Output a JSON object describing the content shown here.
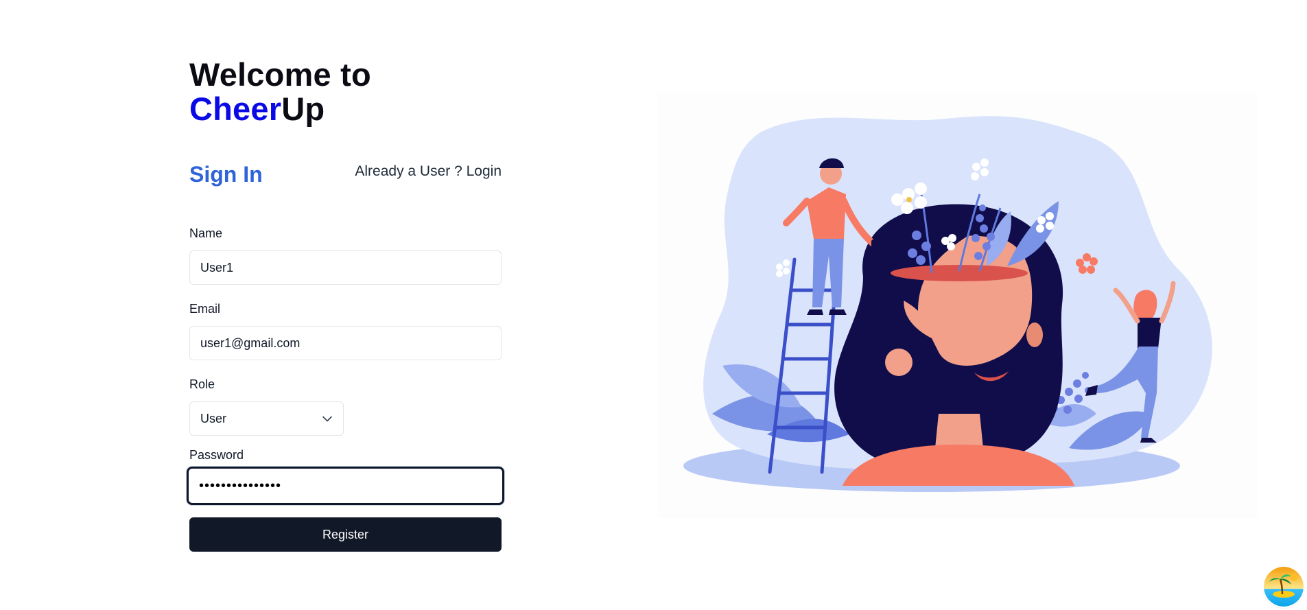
{
  "header": {
    "welcome_line": "Welcome to",
    "brand_part1": "Cheer",
    "brand_part2": "Up"
  },
  "auth": {
    "title": "Sign In",
    "switch_link": "Already a User ? Login"
  },
  "form": {
    "name_label": "Name",
    "name_value": "User1",
    "email_label": "Email",
    "email_value": "user1@gmail.com",
    "role_label": "Role",
    "role_value": "User",
    "password_label": "Password",
    "password_masked": "•••••••••••••••",
    "submit_label": "Register"
  },
  "icons": {
    "role_dropdown": "chevron-down-icon",
    "corner_badge": "palm-island-icon"
  },
  "colors": {
    "brand_blue": "#0a0ae6",
    "signin_blue": "#2f63d9",
    "button_dark": "#111827",
    "illustration_bg": "#d9e3fb",
    "hair_navy": "#100d4a",
    "shirt_coral": "#f77a65"
  }
}
